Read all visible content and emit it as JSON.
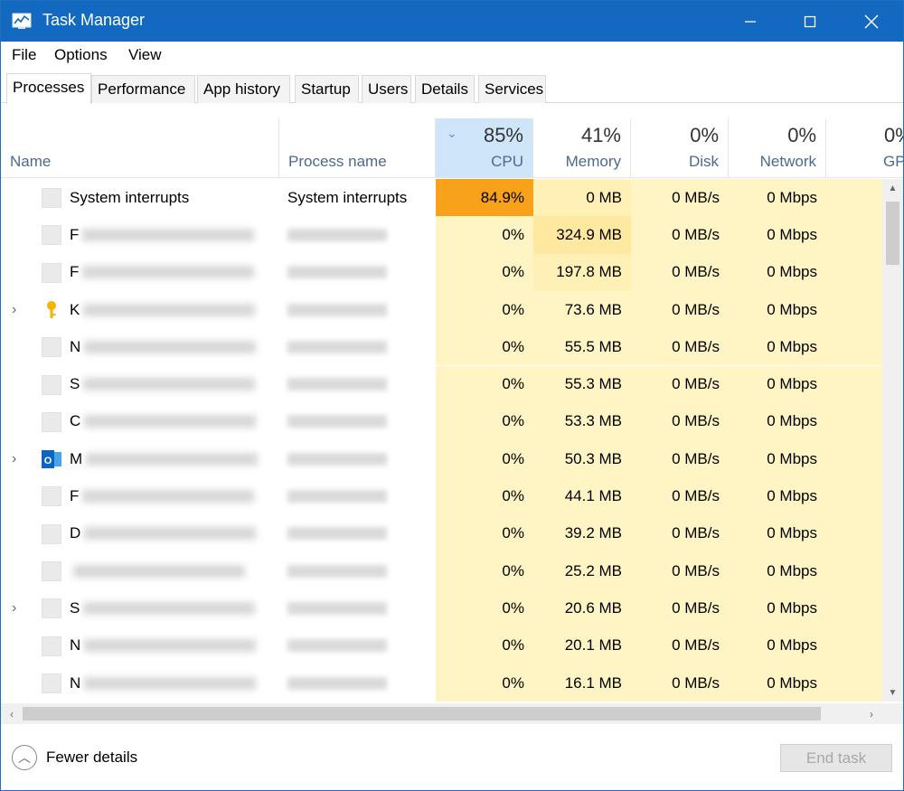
{
  "window": {
    "title": "Task Manager",
    "controls": {
      "minimize": "—",
      "maximize": "☐",
      "close": "✕"
    }
  },
  "menu": [
    "File",
    "Options",
    "View"
  ],
  "tabs": [
    "Processes",
    "Performance",
    "App history",
    "Startup",
    "Users",
    "Details",
    "Services"
  ],
  "active_tab": "Processes",
  "columns": {
    "name": {
      "label": "Name"
    },
    "process_name": {
      "label": "Process name"
    },
    "cpu": {
      "percent": "85%",
      "label": "CPU",
      "sort": "descending"
    },
    "memory": {
      "percent": "41%",
      "label": "Memory"
    },
    "disk": {
      "percent": "0%",
      "label": "Disk"
    },
    "network": {
      "percent": "0%",
      "label": "Network"
    },
    "gpu": {
      "percent": "0%",
      "label": "GP"
    }
  },
  "rows": [
    {
      "expandable": false,
      "icon": "default-process-icon",
      "name_visible": "System interrupts",
      "name_initial": "",
      "process_visible": "System interrupts",
      "cpu": "84.9%",
      "memory": "0 MB",
      "disk": "0 MB/s",
      "network": "0 Mbps",
      "highlight_cpu": true
    },
    {
      "expandable": false,
      "icon": "default-process-icon",
      "name_visible": "",
      "name_initial": "F",
      "process_visible": "",
      "cpu": "0%",
      "memory": "324.9 MB",
      "disk": "0 MB/s",
      "network": "0 Mbps",
      "highlight_cpu": false
    },
    {
      "expandable": false,
      "icon": "default-process-icon",
      "name_visible": "",
      "name_initial": "F",
      "process_visible": "",
      "cpu": "0%",
      "memory": "197.8 MB",
      "disk": "0 MB/s",
      "network": "0 Mbps",
      "highlight_cpu": false
    },
    {
      "expandable": true,
      "icon": "key-icon",
      "name_visible": "",
      "name_initial": "K",
      "process_visible": "",
      "cpu": "0%",
      "memory": "73.6 MB",
      "disk": "0 MB/s",
      "network": "0 Mbps",
      "highlight_cpu": false
    },
    {
      "expandable": false,
      "icon": "default-process-icon",
      "name_visible": "",
      "name_initial": "N",
      "process_visible": "",
      "cpu": "0%",
      "memory": "55.5 MB",
      "disk": "0 MB/s",
      "network": "0 Mbps",
      "highlight_cpu": false
    },
    {
      "expandable": false,
      "icon": "default-process-icon",
      "name_visible": "",
      "name_initial": "S",
      "process_visible": "",
      "cpu": "0%",
      "memory": "55.3 MB",
      "disk": "0 MB/s",
      "network": "0 Mbps",
      "highlight_cpu": false
    },
    {
      "expandable": false,
      "icon": "default-process-icon",
      "name_visible": "",
      "name_initial": "C",
      "process_visible": "",
      "cpu": "0%",
      "memory": "53.3 MB",
      "disk": "0 MB/s",
      "network": "0 Mbps",
      "highlight_cpu": false
    },
    {
      "expandable": true,
      "icon": "outlook-icon",
      "name_visible": "",
      "name_initial": "M",
      "process_visible": "",
      "cpu": "0%",
      "memory": "50.3 MB",
      "disk": "0 MB/s",
      "network": "0 Mbps",
      "highlight_cpu": false
    },
    {
      "expandable": false,
      "icon": "default-process-icon",
      "name_visible": "",
      "name_initial": "F",
      "process_visible": "",
      "cpu": "0%",
      "memory": "44.1 MB",
      "disk": "0 MB/s",
      "network": "0 Mbps",
      "highlight_cpu": false
    },
    {
      "expandable": false,
      "icon": "default-process-icon",
      "name_visible": "",
      "name_initial": "D",
      "process_visible": "",
      "cpu": "0%",
      "memory": "39.2 MB",
      "disk": "0 MB/s",
      "network": "0 Mbps",
      "highlight_cpu": false
    },
    {
      "expandable": false,
      "icon": "default-process-icon",
      "name_visible": "",
      "name_initial": "",
      "process_visible": "",
      "cpu": "0%",
      "memory": "25.2 MB",
      "disk": "0 MB/s",
      "network": "0 Mbps",
      "highlight_cpu": false
    },
    {
      "expandable": true,
      "icon": "default-process-icon",
      "name_visible": "",
      "name_initial": "S",
      "process_visible": "",
      "cpu": "0%",
      "memory": "20.6 MB",
      "disk": "0 MB/s",
      "network": "0 Mbps",
      "highlight_cpu": false
    },
    {
      "expandable": false,
      "icon": "default-process-icon",
      "name_visible": "",
      "name_initial": "N",
      "process_visible": "",
      "cpu": "0%",
      "memory": "20.1 MB",
      "disk": "0 MB/s",
      "network": "0 Mbps",
      "highlight_cpu": false
    },
    {
      "expandable": false,
      "icon": "default-process-icon",
      "name_visible": "",
      "name_initial": "N",
      "process_visible": "",
      "cpu": "0%",
      "memory": "16.1 MB",
      "disk": "0 MB/s",
      "network": "0 Mbps",
      "highlight_cpu": false
    }
  ],
  "footer": {
    "fewer_details": "Fewer details",
    "end_task": "End task"
  },
  "colors": {
    "titlebar": "#1368bf",
    "cpu_hot": "#f7a21a",
    "cell_bg": "#fff4c4",
    "mem_high": "#ffe9a0",
    "sorted_header": "#cfe6fa"
  }
}
